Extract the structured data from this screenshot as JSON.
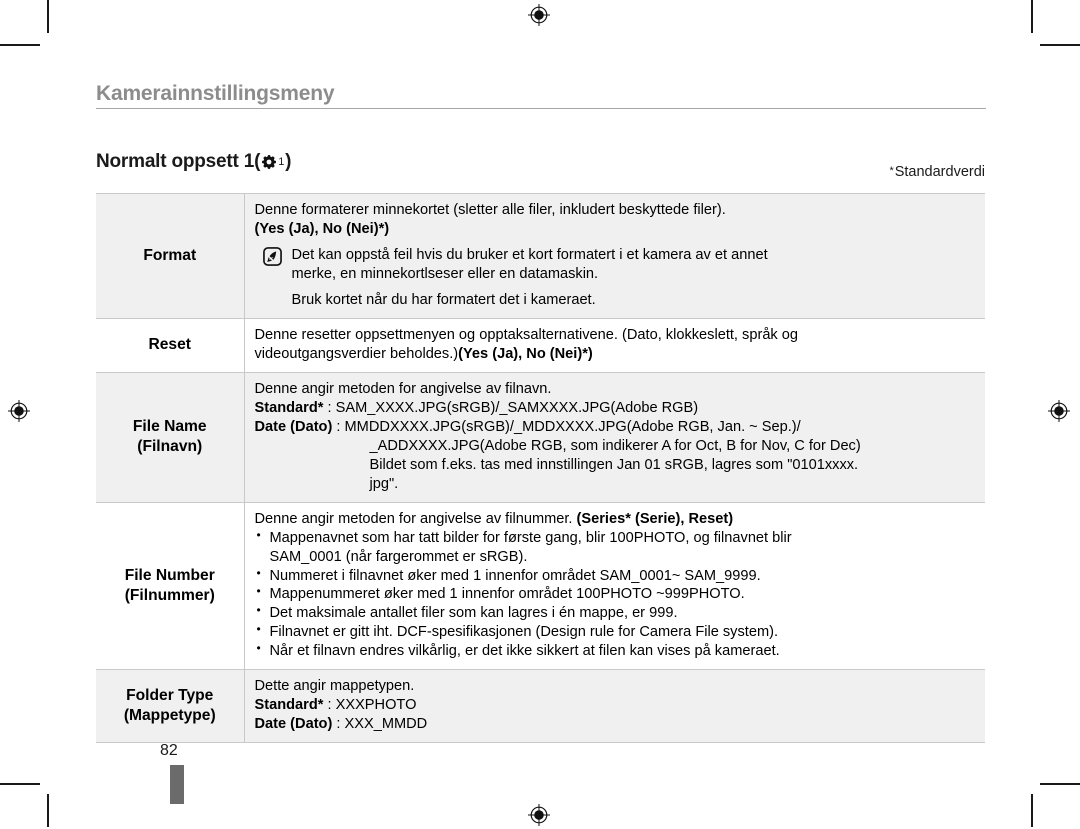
{
  "document": {
    "chapter_title": "Kamerainnstillingsmeny",
    "section_title_prefix": "Normalt oppsett 1(",
    "section_icon": "gear-icon",
    "section_icon_subscript": "1",
    "section_title_suffix": ")",
    "default_value_note": "Standardverdi",
    "default_value_marker": "*",
    "page_number": "82"
  },
  "table": {
    "rows": [
      {
        "label_line1": "Format",
        "label_line2": "",
        "intro": "Denne formaterer minnekortet (sletter alle filer, inkludert beskyttede filer).",
        "options": "(Yes (Ja), No (Nei)*)",
        "note_icon": "samsung-note-pen-icon",
        "note_lines": [
          "Det kan oppstå feil hvis du bruker et kort formatert i et kamera av et annet",
          "merke, en minnekortlseser eller en datamaskin.",
          "Bruk kortet når du har formatert det i kameraet."
        ]
      },
      {
        "label_line1": "Reset",
        "label_line2": "",
        "line1": "Denne resetter oppsettmenyen og opptaksalternativene. (Dato, klokkeslett, språk og",
        "line2_plain": "videoutgangsverdier beholdes.)",
        "line2_bold": "(Yes (Ja), No (Nei)*)"
      },
      {
        "label_line1": "File Name",
        "label_line2": "(Filnavn)",
        "intro": "Denne angir metoden for angivelse av filnavn.",
        "std_label": "Standard*",
        "std_value": " : SAM_XXXX.JPG(sRGB)/_SAMXXXX.JPG(Adobe RGB)",
        "date_label": "Date (Dato)",
        "date_value": " : MMDDXXXX.JPG(sRGB)/_MDDXXXX.JPG(Adobe RGB, Jan. ~ Sep.)/",
        "date_cont1": "_ADDXXXX.JPG(Adobe RGB, som indikerer A for Oct, B for Nov, C for Dec)",
        "date_cont2": "Bildet som f.eks. tas med innstillingen Jan 01 sRGB, lagres som \"0101xxxx.",
        "date_cont3": "jpg\"."
      },
      {
        "label_line1": "File Number",
        "label_line2": "(Filnummer)",
        "intro_plain": "Denne angir metoden for angivelse av filnummer.  ",
        "intro_bold": "(Series* (Serie), Reset)",
        "bullets": [
          {
            "text": "Mappenavnet som har tatt bilder for første gang, blir 100PHOTO, og filnavnet blir",
            "cont": "SAM_0001 (når fargerommet er sRGB)."
          },
          {
            "text": "Nummeret i filnavnet øker med 1 innenfor området SAM_0001~ SAM_9999.",
            "cont": ""
          },
          {
            "text": "Mappenummeret øker med 1 innenfor området 100PHOTO ~999PHOTO.",
            "cont": ""
          },
          {
            "text": "Det maksimale antallet filer som kan lagres i én mappe, er 999.",
            "cont": ""
          },
          {
            "text": "Filnavnet er gitt iht. DCF-spesifikasjonen (Design rule for Camera File system).",
            "cont": ""
          },
          {
            "text": "Når et filnavn endres vilkårlig, er det ikke sikkert at filen kan vises på kameraet.",
            "cont": ""
          }
        ]
      },
      {
        "label_line1": "Folder Type",
        "label_line2": "(Mappetype)",
        "intro": "Dette angir mappetypen.",
        "std_label": "Standard*",
        "std_value": " : XXXPHOTO",
        "date_label": "Date (Dato)",
        "date_value": " : XXX_MMDD"
      }
    ]
  },
  "print_marks": {
    "registration_icon": "registration-target-icon",
    "crop_icon": "crop-mark"
  }
}
